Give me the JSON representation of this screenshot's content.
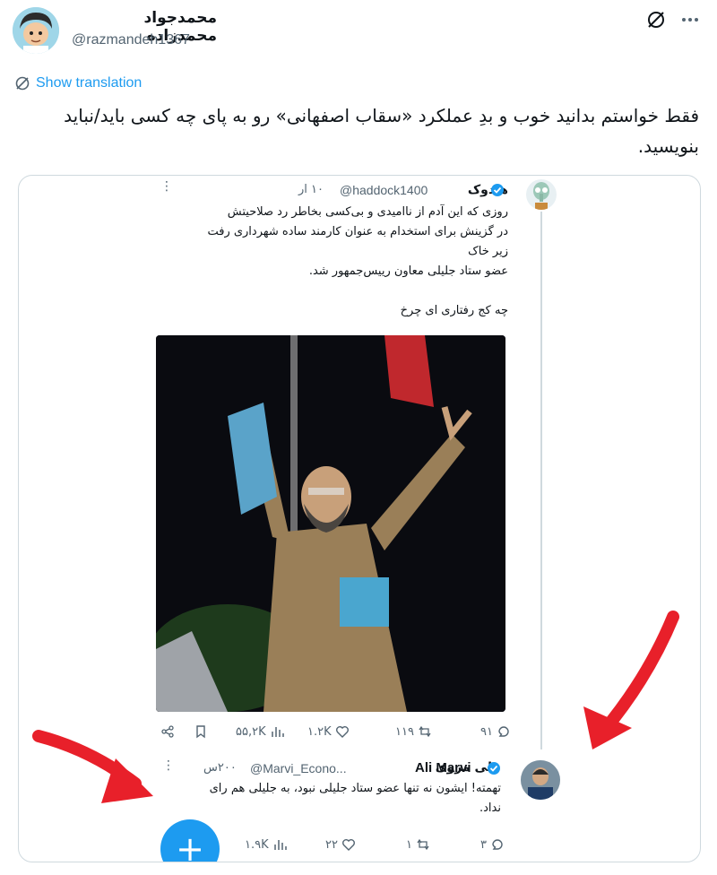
{
  "author": {
    "name": "محمدجواد محمدزاده",
    "handle": "@razmandeh1367"
  },
  "top_icons": [
    "grok-slash-icon",
    "more-icon"
  ],
  "translate": {
    "label": "Show translation"
  },
  "tweet": {
    "text": "فقط خواستم بدانید خوب و بدِ عملکرد «سقاب اصفهانی» رو به پای چه کسی باید/نباید بنویسید."
  },
  "embedded": {
    "post1": {
      "name": "هادوک",
      "handle": "@haddock1400",
      "time": "۱۰ ار",
      "lines": [
        "روزی که این آدم از ناامیدی و بی‌کسی بخاطر رد صلاحیتش",
        "در گزینش برای استخدام به عنوان کارمند ساده شهرداری رفت",
        "زیر خاک",
        "عضو ستاد جلیلی معاون رییس‌جمهور شد.",
        "",
        "چه کج رفتاری ای چرخ"
      ],
      "actions": {
        "replies": "۹۱",
        "reposts": "۱۱۹",
        "likes": "۱.۲K",
        "views": "۵۵,۲K"
      }
    },
    "post2": {
      "name_latin": "Ali Marvi",
      "name_fa": "علی مروی",
      "handle": "@Marvi_Econo...",
      "time": "۲۰۰س",
      "lines": [
        "تهمته! ایشون نه تنها عضو ستاد جلیلی نبود، به جلیلی هم رای",
        "نداد."
      ],
      "actions": {
        "replies": "۳",
        "reposts": "۱",
        "likes": "۲۲",
        "views": "۱.۹K"
      }
    },
    "fab_label": "+"
  },
  "colors": {
    "accent": "#1d9bf0",
    "arrow": "#e8202a",
    "muted": "#536471"
  }
}
